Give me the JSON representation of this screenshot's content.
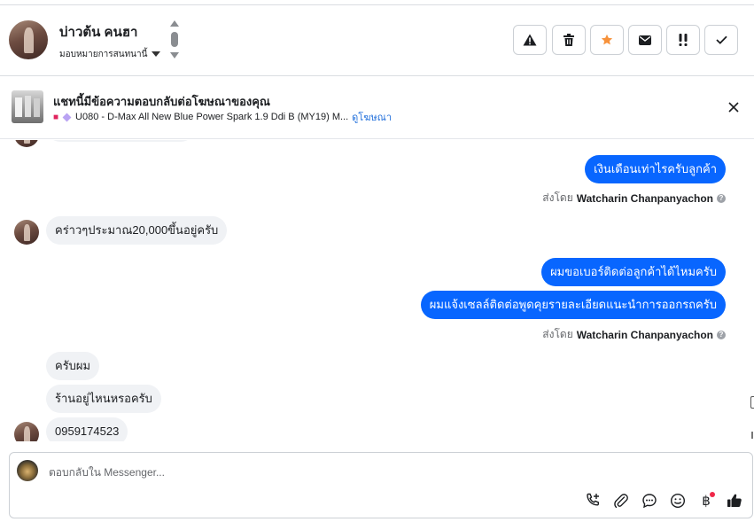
{
  "header": {
    "contact_name": "บ่าวต้น คนฮา",
    "assign_label": "มอบหมายการสนทนานี้",
    "actions": [
      {
        "name": "report",
        "icon": "warning-icon"
      },
      {
        "name": "delete",
        "icon": "trash-icon"
      },
      {
        "name": "star",
        "icon": "star-icon",
        "color": "#f7923b"
      },
      {
        "name": "mark-unread",
        "icon": "envelope-icon"
      },
      {
        "name": "follow-up",
        "icon": "double-exclamation-icon"
      },
      {
        "name": "done",
        "icon": "check-icon"
      }
    ]
  },
  "ad_banner": {
    "title": "แชทนี้มีข้อความตอบกลับต่อโฆษณาของคุณ",
    "subtitle": "U080 - D-Max All New Blue Power Spark 1.9 Ddi B (MY19) M...",
    "link": "ดูโฆษณา"
  },
  "messages": {
    "m1": "เงินเดือนเท่าไรครับลูกค้า",
    "m2": "คร่าวๆประมาณ20,000ขึ้นอยู่ครับ",
    "m3": "ผมขอเบอร์ติดต่อลูกค้าได้ไหมครับ",
    "m4": "ผมแจ้งเซลล์ติดต่อพูดคุยรายละเอียดแนะนำการออกรถครับ",
    "m5": "ครับผม",
    "m6": "ร้านอยู่ไหนหรอครับ",
    "m7": "0959174523",
    "sent_by_prefix": "ส่งโดย",
    "sent_by_name": "Watcharin Chanpanyachon"
  },
  "composer": {
    "placeholder": "ตอบกลับใน Messenger...",
    "tools": [
      "phone-plus-icon",
      "paperclip-icon",
      "chat-bubble-icon",
      "smiley-icon",
      "baht-icon",
      "thumbs-up-icon"
    ],
    "baht_symbol": "฿"
  },
  "colors": {
    "outgoing_bubble": "#0866ff",
    "incoming_bubble": "#f0f2f5",
    "star": "#f7923b",
    "notification_dot": "#f02849",
    "link": "#216fdb"
  }
}
